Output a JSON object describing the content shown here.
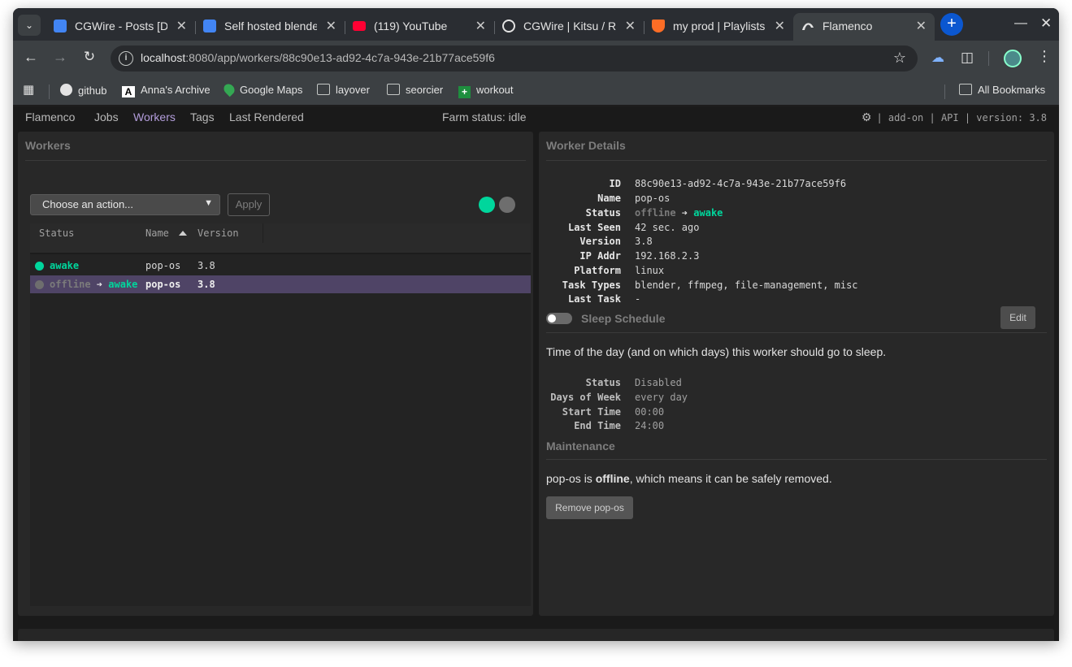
{
  "browser": {
    "tabs": [
      {
        "title": "CGWire - Posts [Dec",
        "icon": "google-docs-icon",
        "color": "#4285f4"
      },
      {
        "title": "Self hosted blender",
        "icon": "google-docs-icon",
        "color": "#4285f4"
      },
      {
        "title": "(119) YouTube",
        "icon": "youtube-icon",
        "color": "#ff0033"
      },
      {
        "title": "CGWire | Kitsu / Re",
        "icon": "github-icon",
        "color": "#e3e3e3"
      },
      {
        "title": "my prod | Playlists",
        "icon": "gitlab-fox-icon",
        "color": "#fc6d26"
      },
      {
        "title": "Flamenco",
        "icon": "flamenco-icon",
        "color": "#e3e3e3"
      }
    ],
    "url_host": "localhost",
    "url_rest": ":8080/app/workers/88c90e13-ad92-4c7a-943e-21b77ace59f6",
    "bookmarks": [
      "github",
      "Anna's Archive",
      "Google Maps",
      "layover",
      "seorcier",
      "workout"
    ],
    "all_bookmarks": "All Bookmarks"
  },
  "app": {
    "nav": [
      "Flamenco",
      "Jobs",
      "Workers",
      "Tags",
      "Last Rendered"
    ],
    "farm_status": "Farm status: idle",
    "right_links": "| add-on | API | version: 3.8",
    "accent_color": "#b39ddb",
    "awake_color": "#00d69c"
  },
  "workers": {
    "title": "Workers",
    "action_placeholder": "Choose an action...",
    "apply_label": "Apply",
    "columns": [
      "Status",
      "Name",
      "Version"
    ],
    "rows": [
      {
        "status_from": "",
        "arrow": "",
        "status_to": "awake",
        "name": "pop-os",
        "version": "3.8"
      },
      {
        "status_from": "offline",
        "arrow": " ➔ ",
        "status_to": "awake",
        "name": "pop-os",
        "version": "3.8"
      }
    ]
  },
  "details": {
    "title": "Worker Details",
    "fields": {
      "id_label": "ID",
      "id": "88c90e13-ad92-4c7a-943e-21b77ace59f6",
      "name_label": "Name",
      "name": "pop-os",
      "status_label": "Status",
      "status_from": "offline",
      "status_arrow": " ➔ ",
      "status_to": "awake",
      "last_seen_label": "Last Seen",
      "last_seen": "42 sec. ago",
      "version_label": "Version",
      "version": "3.8",
      "ip_label": "IP Addr",
      "ip": "192.168.2.3",
      "platform_label": "Platform",
      "platform": "linux",
      "task_types_label": "Task Types",
      "task_types": "blender, ffmpeg, file-management, misc",
      "last_task_label": "Last Task",
      "last_task": "-"
    },
    "sleep": {
      "title": "Sleep Schedule",
      "edit_label": "Edit",
      "description": "Time of the day (and on which days) this worker should go to sleep.",
      "status_label": "Status",
      "status": "Disabled",
      "days_label": "Days of Week",
      "days": "every day",
      "start_label": "Start Time",
      "start": "00:00",
      "end_label": "End Time",
      "end": "24:00"
    },
    "maintenance": {
      "title": "Maintenance",
      "text_pre": "pop-os is ",
      "text_bold": "offline",
      "text_post": ", which means it can be safely removed.",
      "remove_label": "Remove pop-os"
    }
  }
}
